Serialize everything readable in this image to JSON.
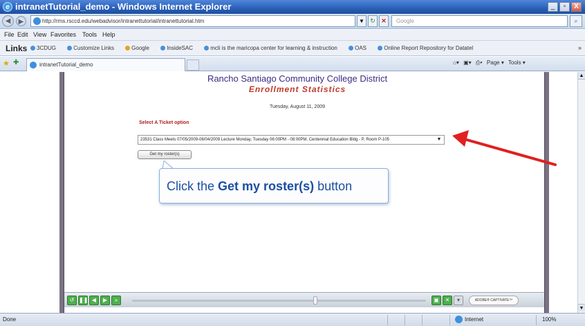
{
  "window": {
    "title": "intranetTutorial_demo - Windows Internet Explorer",
    "min": "_",
    "max": "▫",
    "close": "X"
  },
  "address": {
    "url": "http://rms.rsccd.edu/webadvisor/intranettutorial/intranettutorial.htm",
    "search_placeholder": "Google"
  },
  "menu": [
    "File",
    "Edit",
    "View",
    "Favorites",
    "Tools",
    "Help"
  ],
  "links_bar": {
    "label": "Links",
    "items": [
      "3CDUG",
      "Customize Links",
      "Google",
      "InsideSAC",
      "mcli is the maricopa center for learning & instruction",
      "OAS",
      "Online Report Repository for Datatel"
    ]
  },
  "tab": {
    "title": "intranetTutorial_demo"
  },
  "command_bar": [
    "Page ▾",
    "Tools ▾"
  ],
  "page": {
    "headline": "Rancho Santiago Community College District",
    "subline": "Enrollment Statistics",
    "date": "Tuesday, August 11, 2009",
    "select_label": "Select A Ticket option",
    "ticket_value": "23531 Class Meets 07/05/2009-08/04/2009 Lecture Monday, Tuesday 06:00PM - 08:00PM, Centennial Education Bldg - P, Room P-105",
    "get_roster_label": "Get my roster(s)",
    "callout_pre": "Click the ",
    "callout_bold": "Get my roster(s)",
    "callout_post": " button",
    "arrow_color": "#e02020"
  },
  "playbar": {
    "badge": "ADOBE® CAPTIVATE™"
  },
  "status": {
    "text": "Done",
    "zone": "Internet",
    "zoom": "100%"
  }
}
